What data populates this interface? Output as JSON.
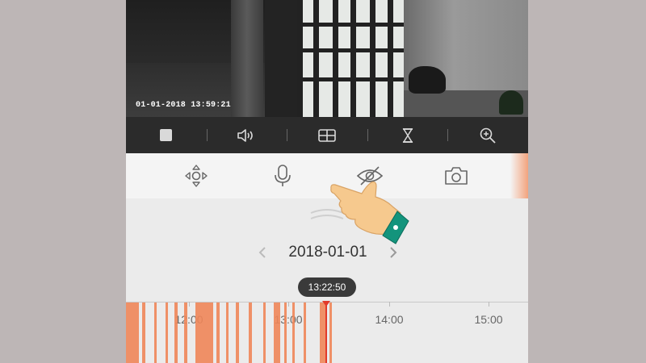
{
  "video": {
    "timestamp": "01-01-2018 13:59:21"
  },
  "control_bar": {
    "items": [
      "stop-icon",
      "speaker-icon",
      "layout-icon",
      "hourglass-icon",
      "zoom-in-icon"
    ]
  },
  "feature_bar": {
    "items": [
      "ptz-move-icon",
      "microphone-icon",
      "privacy-eye-icon",
      "camera-snapshot-icon"
    ]
  },
  "playback": {
    "date": "2018-01-01",
    "current_time": "13:22:50",
    "tick_labels": [
      "12:00",
      "13:00",
      "14:00",
      "15:00"
    ]
  },
  "colors": {
    "accent": "#f08659",
    "cursor": "#e23a2a",
    "control_bg": "#2b2b2b"
  }
}
